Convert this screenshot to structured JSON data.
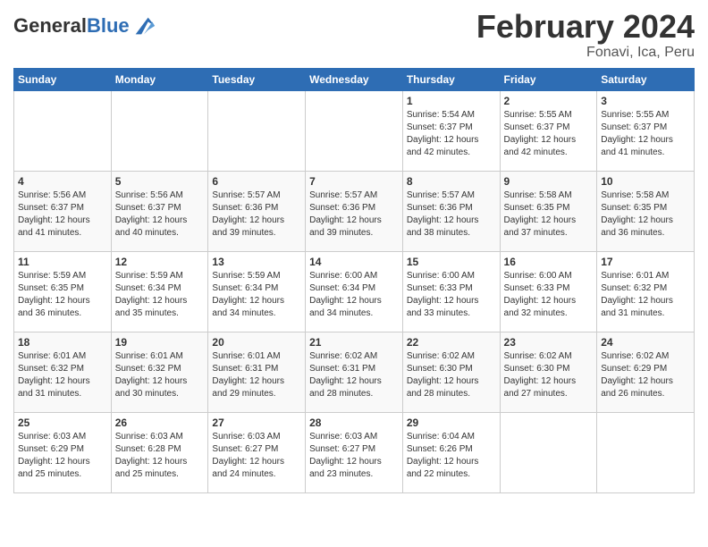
{
  "logo": {
    "general": "General",
    "blue": "Blue"
  },
  "header": {
    "title": "February 2024",
    "subtitle": "Fonavi, Ica, Peru"
  },
  "weekdays": [
    "Sunday",
    "Monday",
    "Tuesday",
    "Wednesday",
    "Thursday",
    "Friday",
    "Saturday"
  ],
  "weeks": [
    [
      {
        "day": "",
        "info": ""
      },
      {
        "day": "",
        "info": ""
      },
      {
        "day": "",
        "info": ""
      },
      {
        "day": "",
        "info": ""
      },
      {
        "day": "1",
        "info": "Sunrise: 5:54 AM\nSunset: 6:37 PM\nDaylight: 12 hours\nand 42 minutes."
      },
      {
        "day": "2",
        "info": "Sunrise: 5:55 AM\nSunset: 6:37 PM\nDaylight: 12 hours\nand 42 minutes."
      },
      {
        "day": "3",
        "info": "Sunrise: 5:55 AM\nSunset: 6:37 PM\nDaylight: 12 hours\nand 41 minutes."
      }
    ],
    [
      {
        "day": "4",
        "info": "Sunrise: 5:56 AM\nSunset: 6:37 PM\nDaylight: 12 hours\nand 41 minutes."
      },
      {
        "day": "5",
        "info": "Sunrise: 5:56 AM\nSunset: 6:37 PM\nDaylight: 12 hours\nand 40 minutes."
      },
      {
        "day": "6",
        "info": "Sunrise: 5:57 AM\nSunset: 6:36 PM\nDaylight: 12 hours\nand 39 minutes."
      },
      {
        "day": "7",
        "info": "Sunrise: 5:57 AM\nSunset: 6:36 PM\nDaylight: 12 hours\nand 39 minutes."
      },
      {
        "day": "8",
        "info": "Sunrise: 5:57 AM\nSunset: 6:36 PM\nDaylight: 12 hours\nand 38 minutes."
      },
      {
        "day": "9",
        "info": "Sunrise: 5:58 AM\nSunset: 6:35 PM\nDaylight: 12 hours\nand 37 minutes."
      },
      {
        "day": "10",
        "info": "Sunrise: 5:58 AM\nSunset: 6:35 PM\nDaylight: 12 hours\nand 36 minutes."
      }
    ],
    [
      {
        "day": "11",
        "info": "Sunrise: 5:59 AM\nSunset: 6:35 PM\nDaylight: 12 hours\nand 36 minutes."
      },
      {
        "day": "12",
        "info": "Sunrise: 5:59 AM\nSunset: 6:34 PM\nDaylight: 12 hours\nand 35 minutes."
      },
      {
        "day": "13",
        "info": "Sunrise: 5:59 AM\nSunset: 6:34 PM\nDaylight: 12 hours\nand 34 minutes."
      },
      {
        "day": "14",
        "info": "Sunrise: 6:00 AM\nSunset: 6:34 PM\nDaylight: 12 hours\nand 34 minutes."
      },
      {
        "day": "15",
        "info": "Sunrise: 6:00 AM\nSunset: 6:33 PM\nDaylight: 12 hours\nand 33 minutes."
      },
      {
        "day": "16",
        "info": "Sunrise: 6:00 AM\nSunset: 6:33 PM\nDaylight: 12 hours\nand 32 minutes."
      },
      {
        "day": "17",
        "info": "Sunrise: 6:01 AM\nSunset: 6:32 PM\nDaylight: 12 hours\nand 31 minutes."
      }
    ],
    [
      {
        "day": "18",
        "info": "Sunrise: 6:01 AM\nSunset: 6:32 PM\nDaylight: 12 hours\nand 31 minutes."
      },
      {
        "day": "19",
        "info": "Sunrise: 6:01 AM\nSunset: 6:32 PM\nDaylight: 12 hours\nand 30 minutes."
      },
      {
        "day": "20",
        "info": "Sunrise: 6:01 AM\nSunset: 6:31 PM\nDaylight: 12 hours\nand 29 minutes."
      },
      {
        "day": "21",
        "info": "Sunrise: 6:02 AM\nSunset: 6:31 PM\nDaylight: 12 hours\nand 28 minutes."
      },
      {
        "day": "22",
        "info": "Sunrise: 6:02 AM\nSunset: 6:30 PM\nDaylight: 12 hours\nand 28 minutes."
      },
      {
        "day": "23",
        "info": "Sunrise: 6:02 AM\nSunset: 6:30 PM\nDaylight: 12 hours\nand 27 minutes."
      },
      {
        "day": "24",
        "info": "Sunrise: 6:02 AM\nSunset: 6:29 PM\nDaylight: 12 hours\nand 26 minutes."
      }
    ],
    [
      {
        "day": "25",
        "info": "Sunrise: 6:03 AM\nSunset: 6:29 PM\nDaylight: 12 hours\nand 25 minutes."
      },
      {
        "day": "26",
        "info": "Sunrise: 6:03 AM\nSunset: 6:28 PM\nDaylight: 12 hours\nand 25 minutes."
      },
      {
        "day": "27",
        "info": "Sunrise: 6:03 AM\nSunset: 6:27 PM\nDaylight: 12 hours\nand 24 minutes."
      },
      {
        "day": "28",
        "info": "Sunrise: 6:03 AM\nSunset: 6:27 PM\nDaylight: 12 hours\nand 23 minutes."
      },
      {
        "day": "29",
        "info": "Sunrise: 6:04 AM\nSunset: 6:26 PM\nDaylight: 12 hours\nand 22 minutes."
      },
      {
        "day": "",
        "info": ""
      },
      {
        "day": "",
        "info": ""
      }
    ]
  ]
}
